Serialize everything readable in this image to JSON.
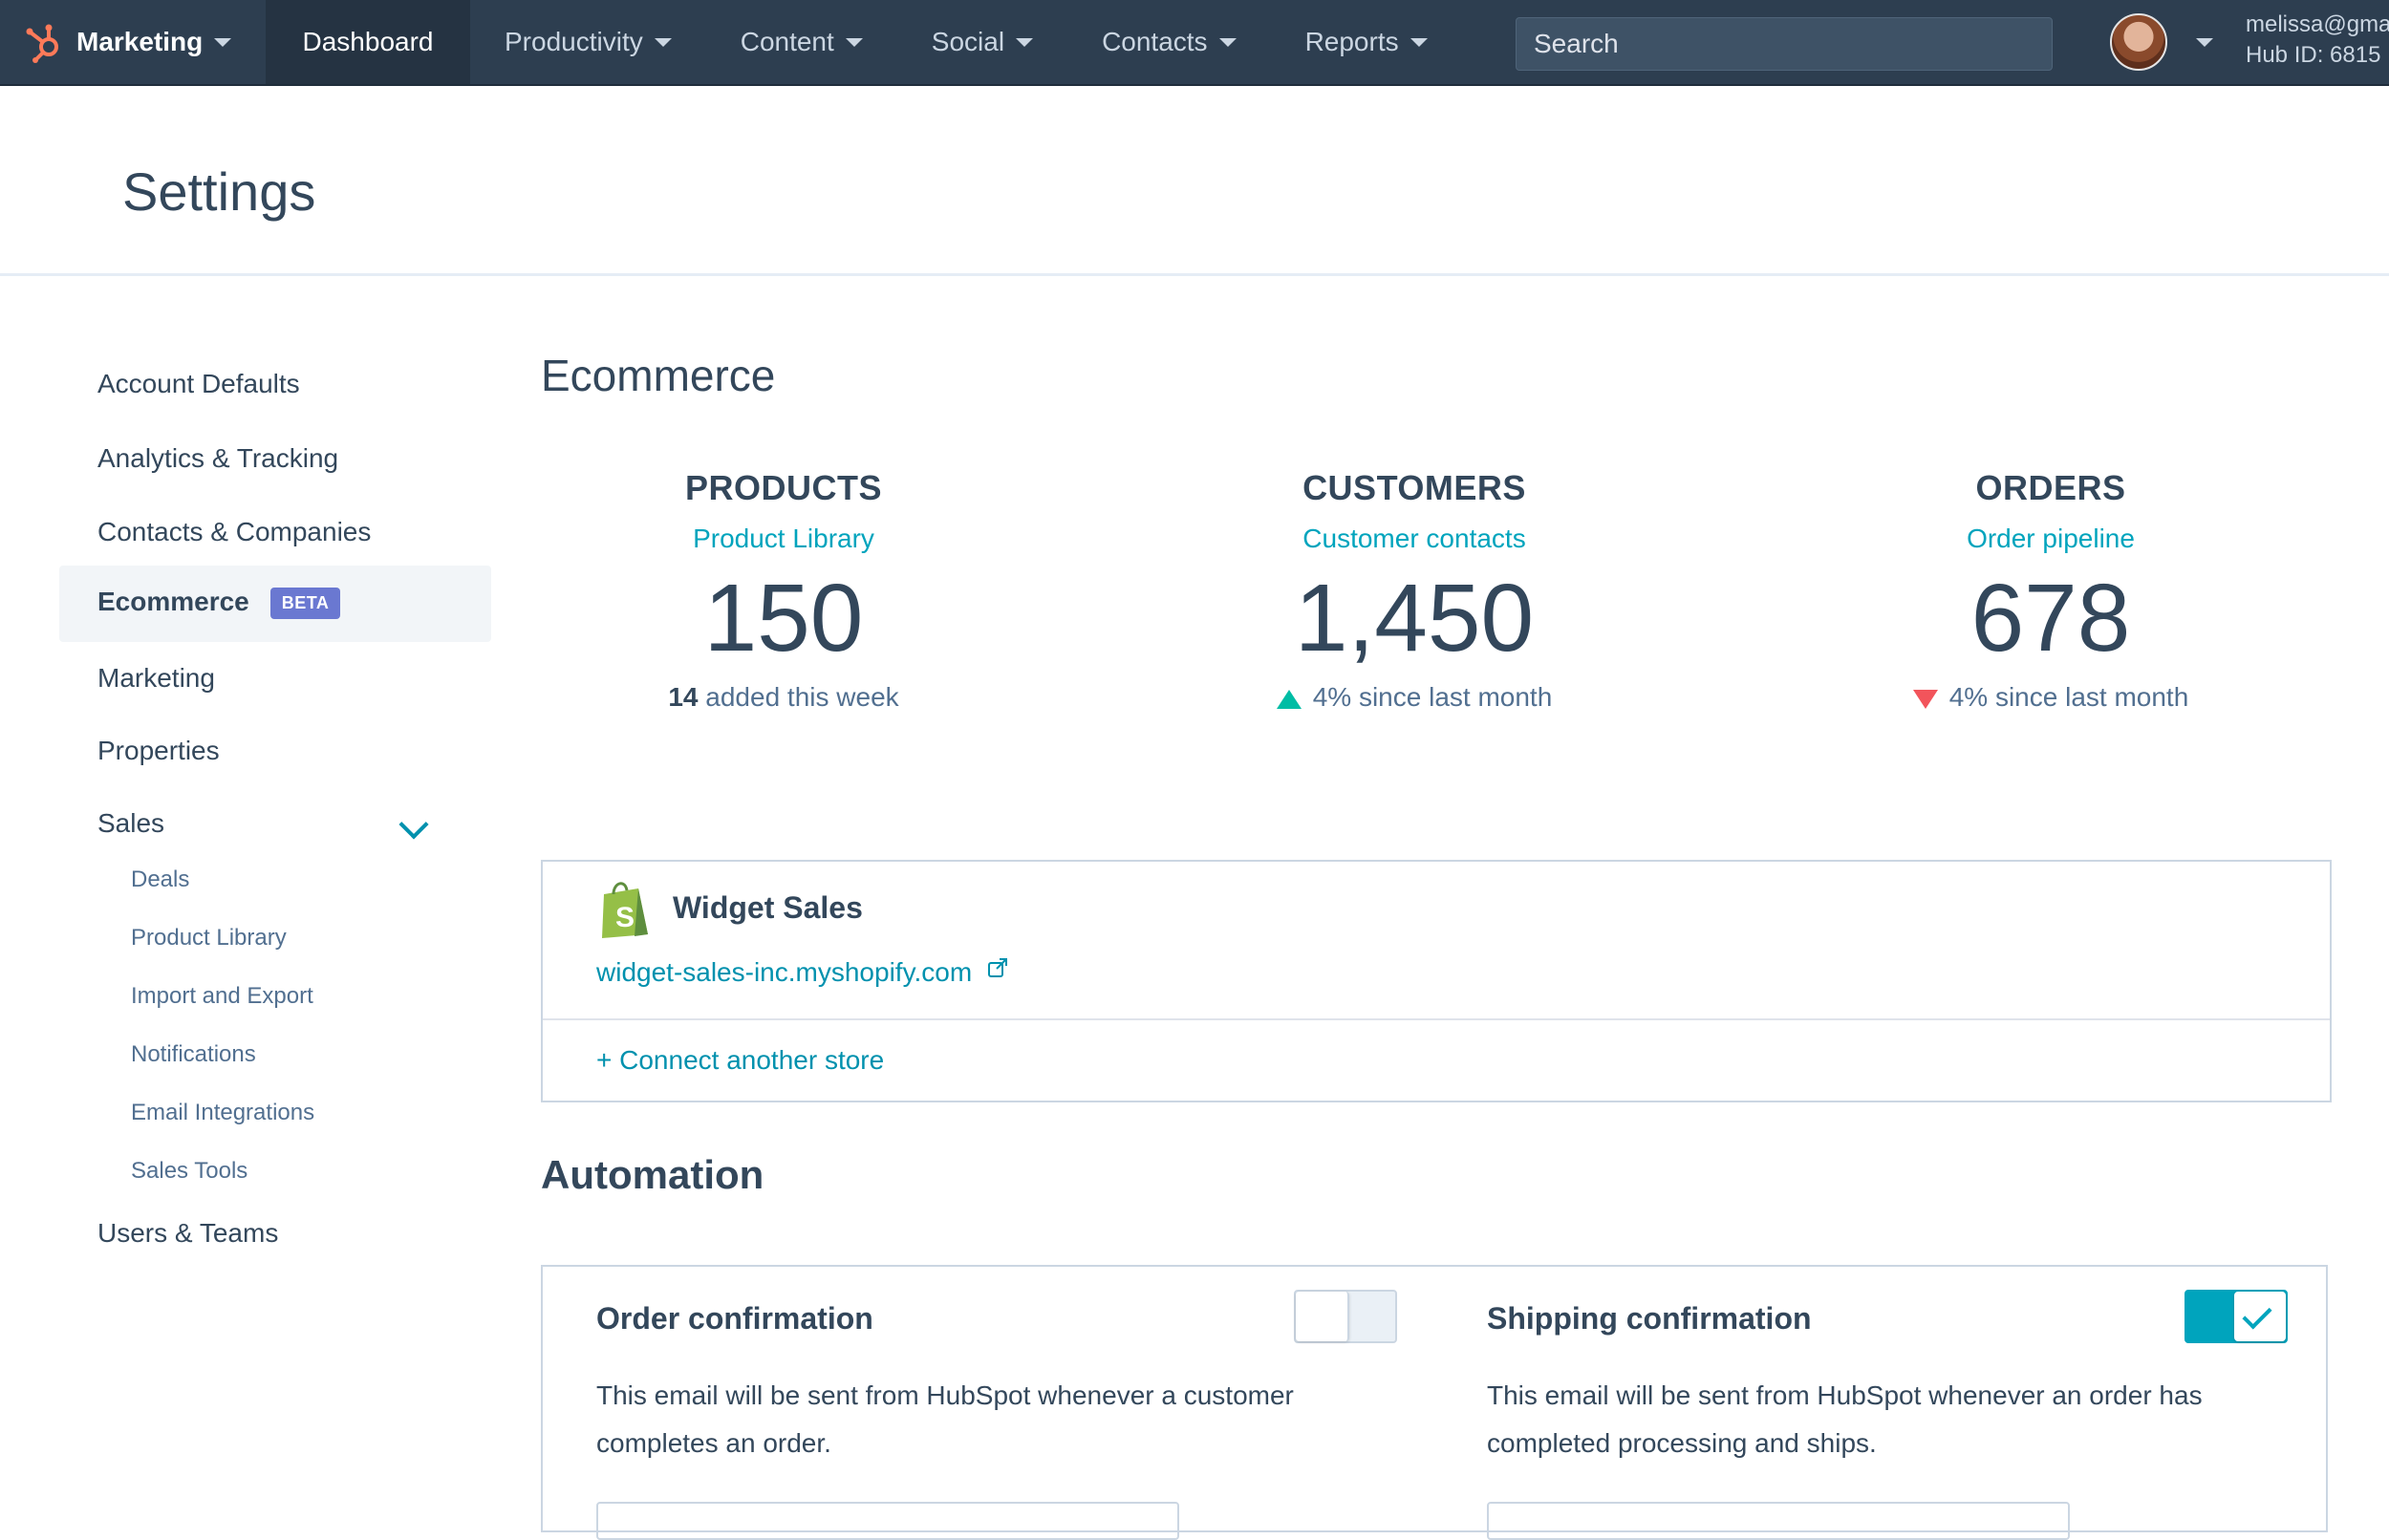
{
  "nav": {
    "brand_label": "Marketing",
    "dashboard_label": "Dashboard",
    "menus": [
      "Productivity",
      "Content",
      "Social",
      "Contacts",
      "Reports"
    ],
    "search_placeholder": "Search",
    "account_email": "melissa@gma",
    "hub_id": "Hub ID: 6815"
  },
  "page": {
    "title": "Settings"
  },
  "sidebar": {
    "items": [
      {
        "label": "Account Defaults"
      },
      {
        "label": "Analytics & Tracking"
      },
      {
        "label": "Contacts & Companies"
      },
      {
        "label": "Ecommerce",
        "badge": "BETA",
        "active": true
      },
      {
        "label": "Marketing"
      },
      {
        "label": "Properties"
      },
      {
        "label": "Sales",
        "expanded": true
      },
      {
        "label": "Users & Teams"
      }
    ],
    "sales_subitems": [
      "Deals",
      "Product Library",
      "Import and Export",
      "Notifications",
      "Email Integrations",
      "Sales Tools"
    ]
  },
  "main": {
    "title": "Ecommerce",
    "stats": [
      {
        "label": "PRODUCTS",
        "link": "Product Library",
        "value": "150",
        "note_strong": "14",
        "note": " added this week",
        "trend": "none"
      },
      {
        "label": "CUSTOMERS",
        "link": "Customer contacts",
        "value": "1,450",
        "note_strong": "",
        "note": "4% since last month",
        "trend": "up"
      },
      {
        "label": "ORDERS",
        "link": "Order pipeline",
        "value": "678",
        "note_strong": "",
        "note": "4% since last month",
        "trend": "down"
      }
    ],
    "store": {
      "name": "Widget Sales",
      "url": "widget-sales-inc.myshopify.com",
      "connect_label": "+ Connect another store"
    },
    "automation": {
      "title": "Automation",
      "cards": [
        {
          "title": "Order confirmation",
          "description": "This email will be sent from HubSpot whenever a customer completes an order.",
          "enabled": false
        },
        {
          "title": "Shipping confirmation",
          "description": "This email will be sent from HubSpot whenever an order has completed processing and ships.",
          "enabled": true
        }
      ]
    }
  },
  "colors": {
    "nav_bg": "#2d3e50",
    "accent": "#00a4bd",
    "link": "#0091ae",
    "up": "#00bda5",
    "down": "#f2545b",
    "beta": "#6a78d1",
    "shopify": "#95bf47"
  },
  "icons": [
    "hubspot-logo-icon",
    "search-icon",
    "chevron-down-icon",
    "shopify-icon",
    "external-link-icon",
    "check-icon",
    "trend-up-icon",
    "trend-down-icon"
  ]
}
